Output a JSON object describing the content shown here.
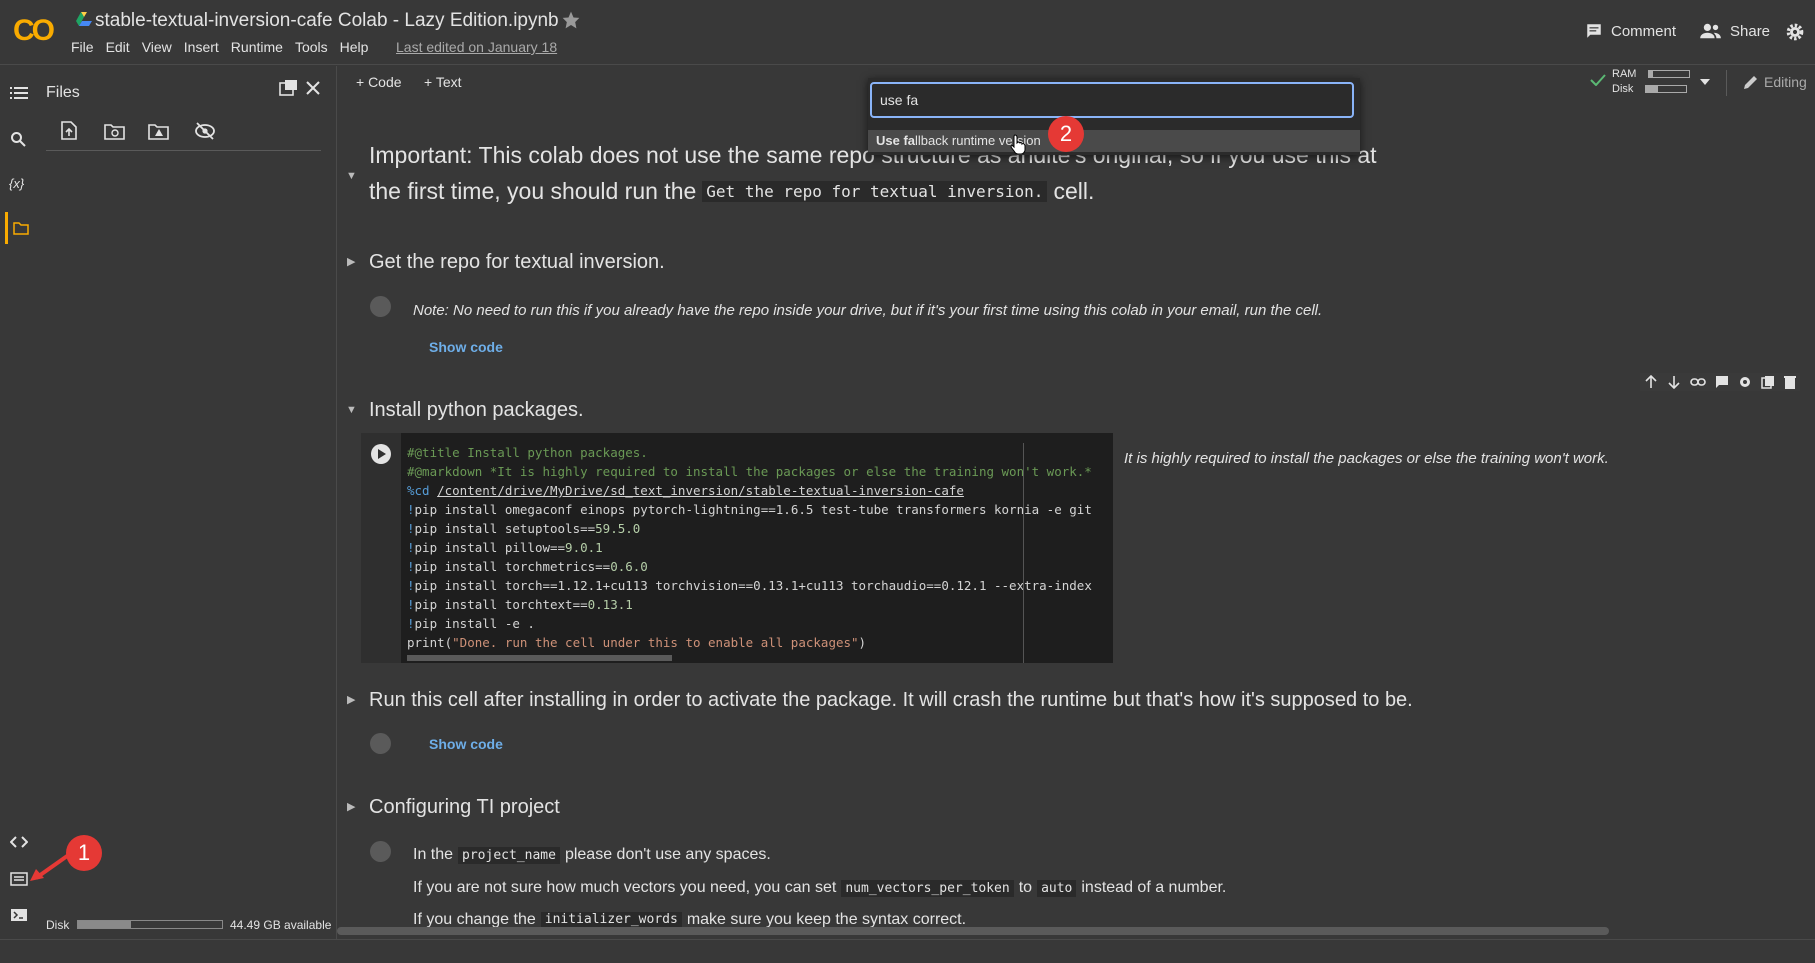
{
  "header": {
    "logo": "CO",
    "title": "stable-textual-inversion-cafe Colab - Lazy Edition.ipynb",
    "menu": [
      "File",
      "Edit",
      "View",
      "Insert",
      "Runtime",
      "Tools",
      "Help"
    ],
    "last_edited": "Last edited on January 18",
    "comment_label": "Comment",
    "share_label": "Share"
  },
  "sidebar": {
    "panel_title": "Files",
    "disk_label": "Disk",
    "disk_fill": 0.37,
    "disk_available": "44.49 GB available"
  },
  "toolbar": {
    "add_code": "+ Code",
    "add_text": "+ Text",
    "ram_label": "RAM",
    "disk_label": "Disk",
    "ram_fill": 0.1,
    "disk_fill": 0.3,
    "mode": "Editing"
  },
  "palette": {
    "input_value": "use fa",
    "result_bold": "Use fa",
    "result_rest": "llback runtime version"
  },
  "cells": {
    "important_line1": "Important: This colab does not use the same repo structure as andite's original, so if you use this at",
    "important_line2a": "the first time, you should run the",
    "important_code": "Get the repo for textual inversion.",
    "important_line2b": "cell.",
    "repo_heading": "Get the repo for textual inversion.",
    "repo_note": "Note: No need to run this if you already have the repo inside your drive, but if it's your first time using this colab in your email, run the cell.",
    "show_code": "Show code",
    "install_heading": "Install python packages.",
    "install_note": "It is highly required to install the packages or else the training won't work.",
    "run_heading": "Run this cell after installing in order to activate the package. It will crash the runtime but that's how it's supposed to be.",
    "config_heading": "Configuring TI project",
    "config_p1a": "In the",
    "config_p1_code": "project_name",
    "config_p1b": "please don't use any spaces.",
    "config_p2a": "If you are not sure how much vectors you need, you can set",
    "config_p2_code1": "num_vectors_per_token",
    "config_p2b": "to",
    "config_p2_code2": "auto",
    "config_p2c": "instead of a number.",
    "config_p3a": "If you change the",
    "config_p3_code": "initializer_words",
    "config_p3b": "make sure you keep the syntax correct."
  },
  "code": {
    "l1": "#@title Install python packages.",
    "l2": "#@markdown *It is highly required to install the packages or else the training won't work.*",
    "l3_kw": "%cd",
    "l3_path": "/content/drive/MyDrive/sd_text_inversion/stable-textual-inversion-cafe",
    "l4_bang": "!",
    "l4": "pip install omegaconf einops pytorch-lightning==1.6.5 test-tube transformers kornia -e git",
    "l5_a": "pip install setuptools==",
    "l5_n": "59.5.0",
    "l6_a": "pip install pillow==",
    "l6_n": "9.0.1",
    "l7_a": "pip install torchmetrics==",
    "l7_n": "0.6.0",
    "l8": "pip install torch==1.12.1+cu113 torchvision==0.13.1+cu113 torchaudio==0.12.1 --extra-index",
    "l9_a": "pip install torchtext==",
    "l9_n": "0.13.1",
    "l10": "pip install -e .",
    "l11_fn": "print(",
    "l11_str": "\"Done. run the cell under this to enable all packages\"",
    "l11_end": ")"
  },
  "annotations": {
    "badge1": "1",
    "badge2": "2"
  },
  "colors": {
    "accent": "#f9ab00",
    "link": "#6eaee8",
    "badge": "#e53935",
    "focus": "#8ab4f8"
  }
}
